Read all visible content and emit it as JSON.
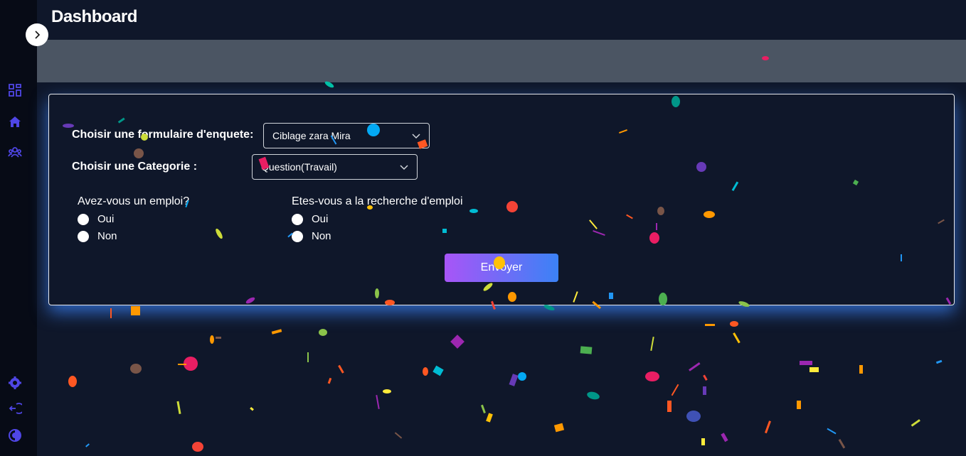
{
  "header": {
    "title": "Dashboard"
  },
  "sidebar": {
    "toggle_icon": "chevron-right-icon",
    "items": [
      {
        "icon": "grid-icon"
      },
      {
        "icon": "home-icon"
      },
      {
        "icon": "users-icon"
      }
    ],
    "bottom_items": [
      {
        "icon": "gear-icon"
      },
      {
        "icon": "logout-icon"
      },
      {
        "icon": "theme-toggle-icon"
      }
    ],
    "icon_color": "#4f46e5"
  },
  "form": {
    "survey_label": "Choisir une formulaire d'enquete:",
    "survey_value": "Ciblage zara Mira",
    "category_label": "Choisir une Categorie :",
    "category_value": "Question(Travail)",
    "questions": [
      {
        "text": "Avez-vous un emploi?",
        "options": [
          "Oui",
          "Non"
        ]
      },
      {
        "text": "Etes-vous a la recherche d'emploi",
        "options": [
          "Oui",
          "Non"
        ]
      }
    ],
    "submit_label": "Envoyer"
  },
  "colors": {
    "background": "#0f172a",
    "banner": "#4b5563",
    "button_gradient_start": "#a855f7",
    "button_gradient_end": "#3b82f6",
    "card_glow": "#3b82f6"
  }
}
